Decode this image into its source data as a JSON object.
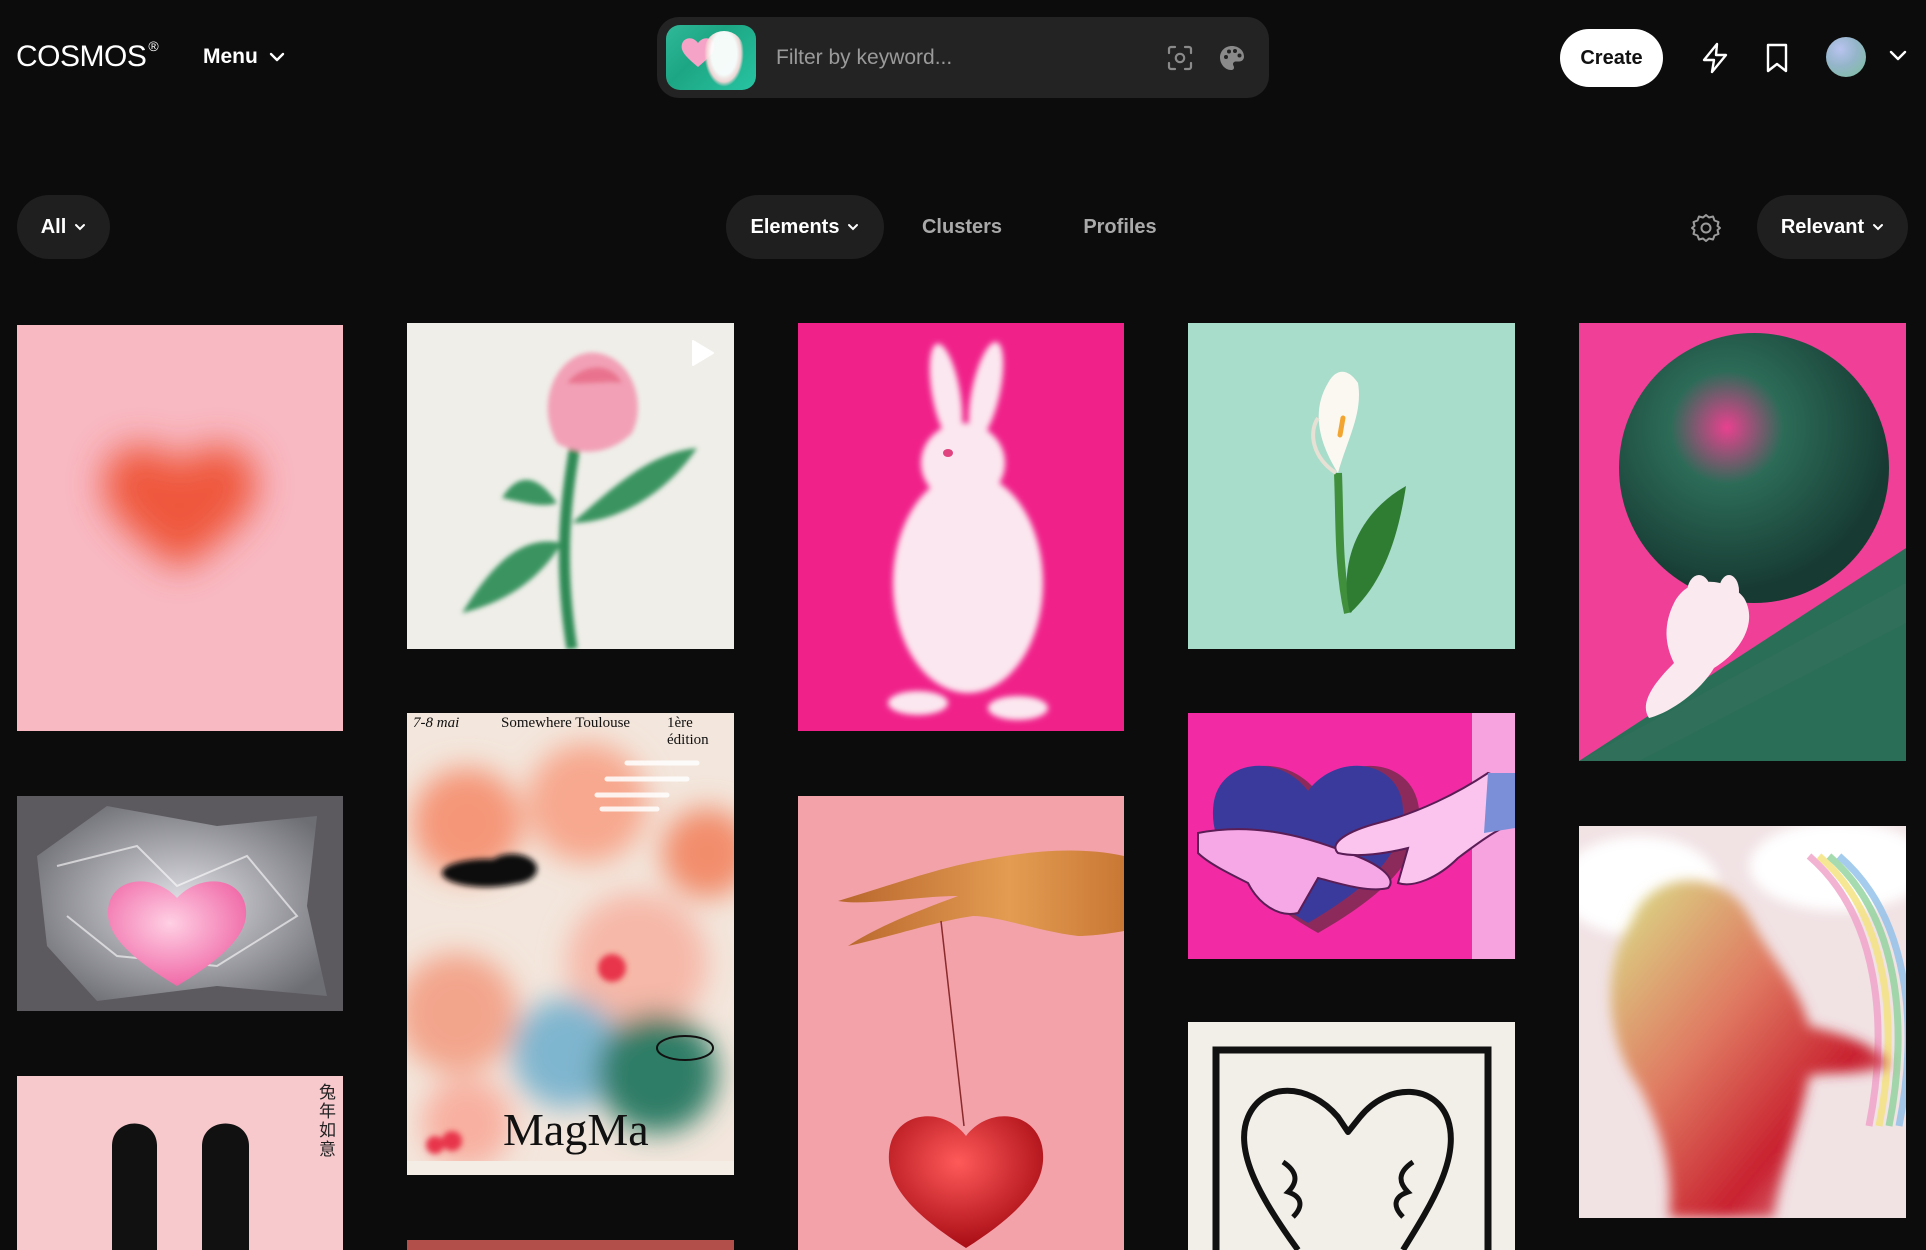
{
  "header": {
    "logo": "COSMOS",
    "logo_mark": "®",
    "menu_label": "Menu",
    "search_placeholder": "Filter by keyword...",
    "create_label": "Create"
  },
  "filters": {
    "scope_label": "All",
    "tabs": [
      {
        "label": "Elements",
        "active": true
      },
      {
        "label": "Clusters",
        "active": false
      },
      {
        "label": "Profiles",
        "active": false
      }
    ],
    "sort_label": "Relevant"
  },
  "grid": {
    "magma_poster": {
      "date": "7-8 mai",
      "event": "Somewhere Toulouse",
      "edition": "1ère édition",
      "title": "MagMa"
    },
    "rabbit_year_text": "兔年如意"
  },
  "colors": {
    "background": "#0c0c0c",
    "search_bg": "#232323",
    "pill_bg": "#1f1f1f",
    "muted_text": "#a9a9a9"
  },
  "icons": [
    "chevron-down-icon",
    "image-search-icon",
    "palette-icon",
    "bolt-icon",
    "bookmark-icon",
    "settings-gear-icon",
    "play-icon"
  ]
}
